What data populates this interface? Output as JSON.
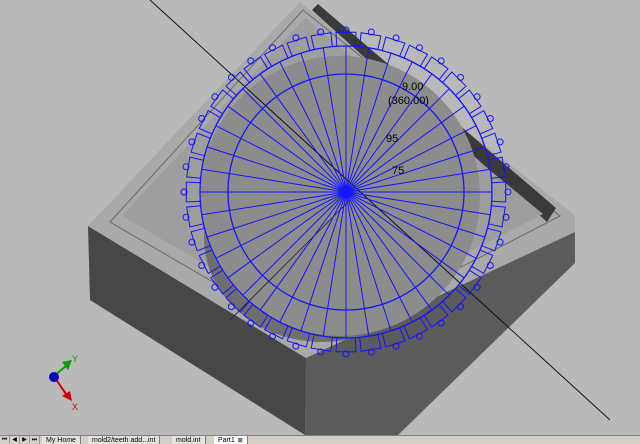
{
  "viewport": {
    "dimensions": {
      "outer_value": "9.00",
      "outer_sub": "(360.00)",
      "inner_a": "95",
      "inner_b": "75"
    },
    "triad": {
      "y_label": "Y",
      "x_label": "X"
    },
    "colors": {
      "background": "#b9b9b9",
      "sketch": "#1414ff",
      "axis_y": "#00a000",
      "axis_x": "#d00000",
      "axis_z": "#0000c0"
    }
  },
  "tabbar": {
    "nav_buttons": [
      "⏮",
      "◀",
      "▶",
      "⏭"
    ],
    "tabs": [
      {
        "label": "My Home"
      },
      {
        "label": "mold2/teeth add...int"
      },
      {
        "label": "mold.int"
      },
      {
        "label": "Part1"
      }
    ],
    "active_tab": "Part1",
    "close_glyph": "⊠"
  }
}
